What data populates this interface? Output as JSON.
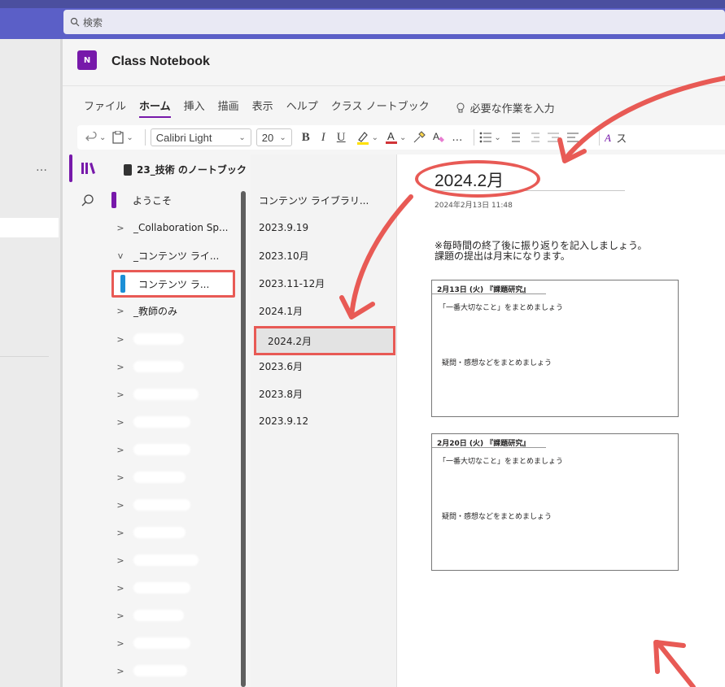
{
  "teams": {
    "search_placeholder": "検索",
    "rail_more": "…"
  },
  "app": {
    "title": "Class Notebook",
    "icon_label": "N"
  },
  "ribbon": {
    "tabs": [
      "ファイル",
      "ホーム",
      "挿入",
      "描画",
      "表示",
      "ヘルプ",
      "クラス ノートブック"
    ],
    "active_tab_index": 1,
    "tell_me": "必要な作業を入力",
    "font_name": "Calibri Light",
    "font_size": "20",
    "bold": "B",
    "italic": "I",
    "underline": "U",
    "more": "…",
    "styles_partial": "ス"
  },
  "notebook": {
    "title": "23_技術 のノートブック",
    "sections": [
      {
        "label": "ようこそ",
        "chevron": ""
      },
      {
        "label": "_Collaboration Sp...",
        "chevron": ">"
      },
      {
        "label": "_コンテンツ ライ...",
        "chevron": "v"
      },
      {
        "label": "コンテンツ ラ...",
        "chevron": ""
      },
      {
        "label": "_教師のみ",
        "chevron": ">"
      }
    ],
    "hidden_chevron": ">"
  },
  "pages": {
    "items": [
      "コンテンツ ライブラリ...",
      "2023.9.19",
      "2023.10月",
      "2023.11-12月",
      "2024.1月",
      "2024.2月",
      "2023.6月",
      "2023.8月",
      "2023.9.12"
    ],
    "selected_index": 5
  },
  "page": {
    "title": "2024.2月",
    "date": "2024年2月13日    11:48",
    "note_line1": "※毎時間の終了後に振り返りを記入しましょう。",
    "note_line2": "課題の提出は月末になります。",
    "cards": [
      {
        "header": "2月13日 (火) 『課題研究』",
        "line1": "「一番大切なこと」をまとめましょう",
        "line2": "疑問・感想などをまとめましょう"
      },
      {
        "header": "2月20日 (火) 『課題研究』",
        "line1": "「一番大切なこと」をまとめましょう",
        "line2": "疑問・感想などをまとめましょう"
      }
    ]
  },
  "colors": {
    "teams_bar": "#5b5fc7",
    "onenote_purple": "#7719aa",
    "annotation_red": "#e85a55",
    "section_blue": "#1c8fd6"
  }
}
